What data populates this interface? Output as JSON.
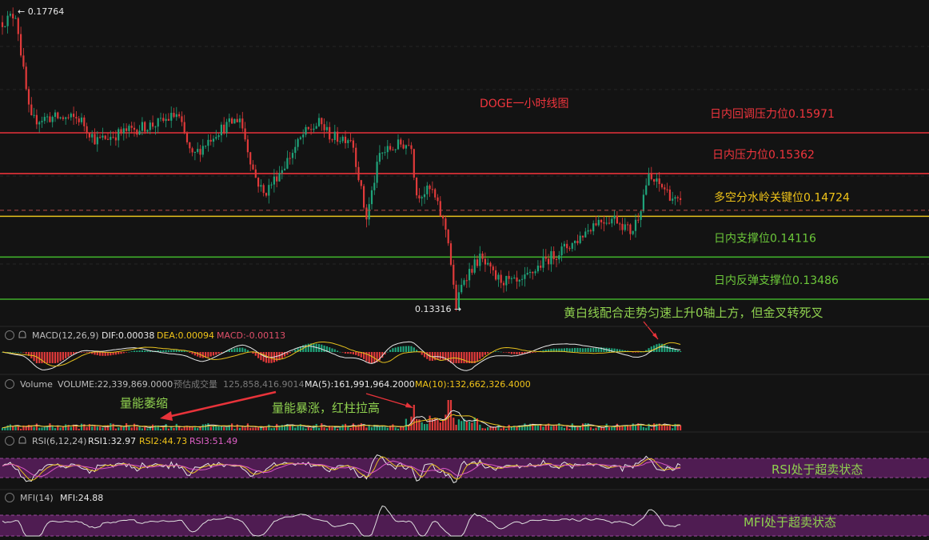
{
  "colors": {
    "background": "#131313",
    "up": "#1fa37a",
    "down": "#e03a3a",
    "red_line": "#e8333a",
    "yellow_line": "#e6c11e",
    "green_line": "#3fae2a",
    "annotation_green": "#8fd14f",
    "label_red": "#f0353d",
    "label_yellow": "#f0c419",
    "label_green": "#6cc83a",
    "oversold_band": "#5b1f5e"
  },
  "main": {
    "title": "DOGE一小时线图",
    "high_marker": "← 0.17764",
    "low_marker": "0.13316 →",
    "levels": [
      {
        "label": "日内回调压力位0.15971",
        "value": 0.15971,
        "color": "red"
      },
      {
        "label": "日内压力位0.15362",
        "value": 0.15362,
        "color": "red"
      },
      {
        "label": "多空分水岭关键位0.14724",
        "value": 0.14724,
        "color": "yellow"
      },
      {
        "label": "日内支撑位0.14116",
        "value": 0.14116,
        "color": "green"
      },
      {
        "label": "日内反弹支撑位0.13486",
        "value": 0.13486,
        "color": "green"
      }
    ],
    "current_price": 0.1485,
    "annotation": "黄白线配合走势匀速上升0轴上方，但金叉转死叉"
  },
  "macd": {
    "name": "MACD(12,26,9)",
    "dif": "DIF:0.00038",
    "dea": "DEA:0.00094",
    "macd": "MACD:-0.00113"
  },
  "volume": {
    "name": "Volume",
    "volume": "VOLUME:22,339,869.0000",
    "estimate_label": "预估成交量",
    "estimate_value": "125,858,416.9014",
    "ma5": "MA(5):161,991,964.2000",
    "ma10": "MA(10):132,662,326.4000",
    "annotation_shrink": "量能萎缩",
    "annotation_surge": "量能暴涨，红柱拉高"
  },
  "rsi": {
    "name": "RSI(6,12,24)",
    "rsi1": "RSI1:32.97",
    "rsi2": "RSI2:44.73",
    "rsi3": "RSI3:51.49",
    "annotation": "RSI处于超卖状态"
  },
  "mfi": {
    "name": "MFI(14)",
    "mfi": "MFI:24.88",
    "annotation": "MFI处于超卖状态"
  },
  "chart_data": {
    "type": "candlestick",
    "title": "DOGE一小时线图",
    "price_path": [
      [
        0,
        0.176
      ],
      [
        20,
        0.1775
      ],
      [
        28,
        0.17
      ],
      [
        38,
        0.1615
      ],
      [
        60,
        0.162
      ],
      [
        100,
        0.1618
      ],
      [
        120,
        0.1585
      ],
      [
        160,
        0.16
      ],
      [
        200,
        0.1612
      ],
      [
        222,
        0.1625
      ],
      [
        240,
        0.156
      ],
      [
        270,
        0.1598
      ],
      [
        300,
        0.162
      ],
      [
        318,
        0.1535
      ],
      [
        330,
        0.1505
      ],
      [
        355,
        0.1548
      ],
      [
        380,
        0.1595
      ],
      [
        400,
        0.1612
      ],
      [
        415,
        0.159
      ],
      [
        440,
        0.159
      ],
      [
        458,
        0.1468
      ],
      [
        475,
        0.1565
      ],
      [
        500,
        0.158
      ],
      [
        515,
        0.158
      ],
      [
        520,
        0.1505
      ],
      [
        540,
        0.1512
      ],
      [
        560,
        0.1445
      ],
      [
        570,
        0.1335
      ],
      [
        580,
        0.138
      ],
      [
        600,
        0.141
      ],
      [
        620,
        0.138
      ],
      [
        650,
        0.137
      ],
      [
        680,
        0.1405
      ],
      [
        720,
        0.1435
      ],
      [
        745,
        0.1465
      ],
      [
        770,
        0.147
      ],
      [
        790,
        0.1448
      ],
      [
        800,
        0.148
      ],
      [
        810,
        0.153
      ],
      [
        830,
        0.1515
      ],
      [
        845,
        0.1495
      ],
      [
        855,
        0.1485
      ]
    ],
    "annotations": [
      "日内回调压力位0.15971",
      "日内压力位0.15362",
      "多空分水岭关键位0.14724",
      "日内支撑位0.14116",
      "日内反弹支撑位0.13486"
    ]
  }
}
